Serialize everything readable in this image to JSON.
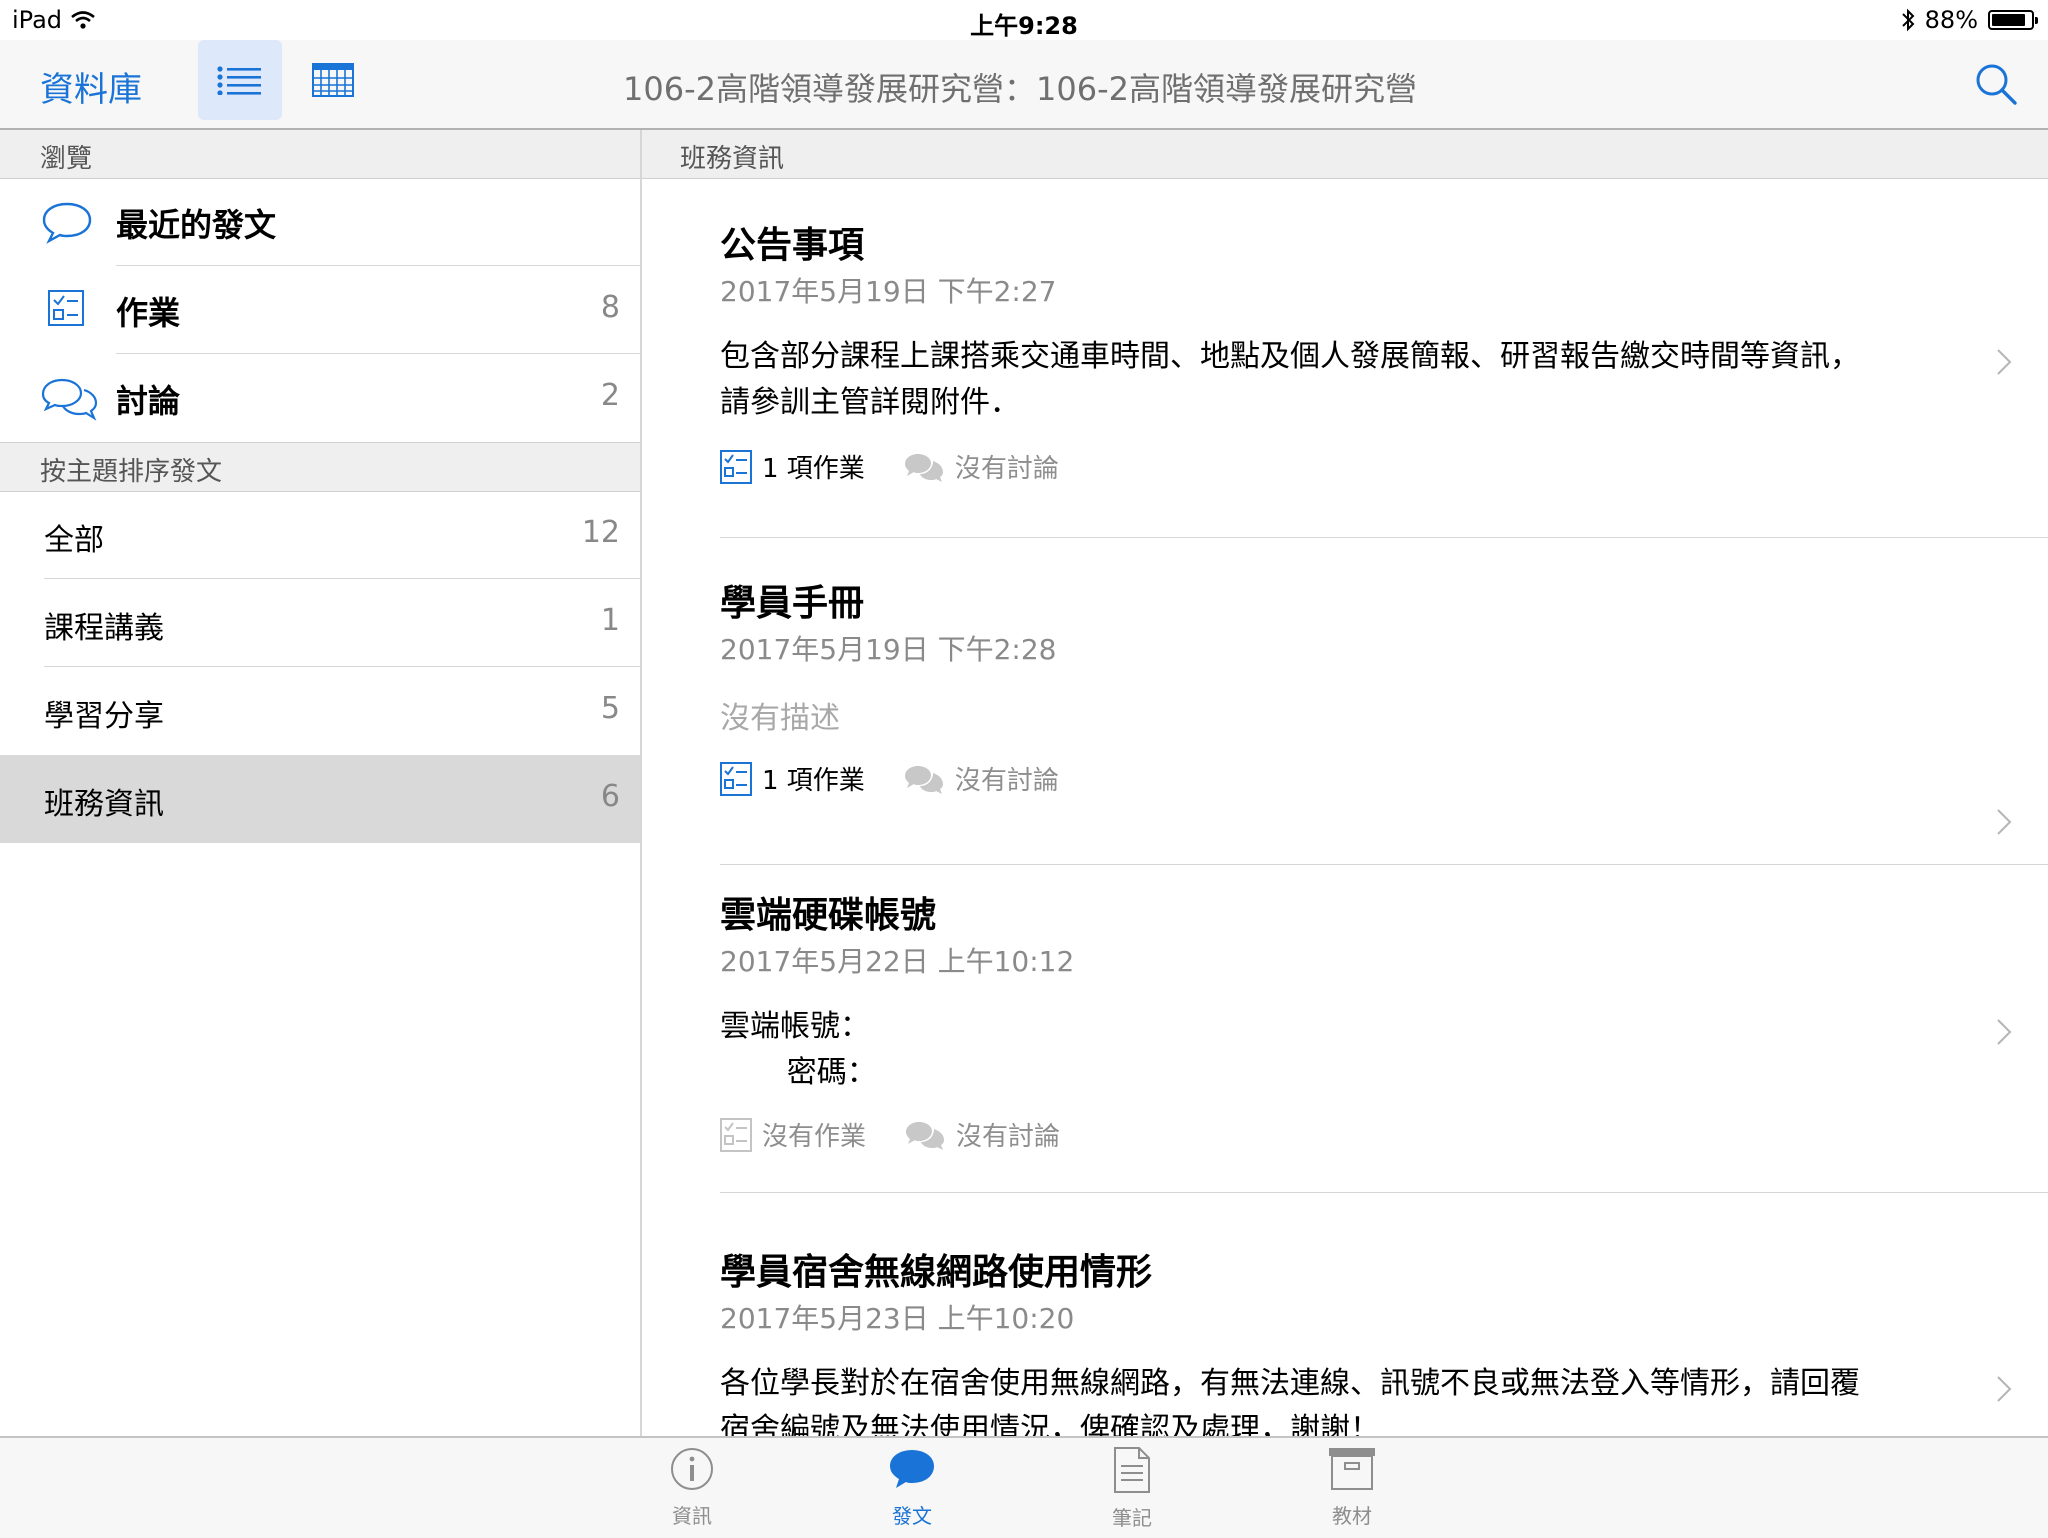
{
  "status_bar": {
    "device": "iPad",
    "time": "上午9:28",
    "battery": "88%",
    "battery_level": 0.88
  },
  "navbar": {
    "back_label": "資料庫",
    "title": "106-2高階領導發展研究營：106-2高階領導發展研究營"
  },
  "sidebar": {
    "browse_header": "瀏覽",
    "browse_items": [
      {
        "label": "最近的發文",
        "count": ""
      },
      {
        "label": "作業",
        "count": "8"
      },
      {
        "label": "討論",
        "count": "2"
      }
    ],
    "topic_header": "按主題排序發文",
    "topics": [
      {
        "label": "全部",
        "count": "12"
      },
      {
        "label": "課程講義",
        "count": "1"
      },
      {
        "label": "學習分享",
        "count": "5"
      },
      {
        "label": "班務資訊",
        "count": "6",
        "selected": true
      }
    ]
  },
  "main": {
    "header": "班務資訊",
    "posts": [
      {
        "title": "公告事項",
        "date": "2017年5月19日 下午2:27",
        "body": "包含部分課程上課搭乘交通車時間、地點及個人發展簡報、研習報告繳交時間等資訊，\n請參訓主管詳閱附件．",
        "assignments": "1 項作業",
        "discussions": "沒有討論"
      },
      {
        "title": "學員手冊",
        "date": "2017年5月19日 下午2:28",
        "body": "沒有描述",
        "assignments": "1 項作業",
        "discussions": "沒有討論"
      },
      {
        "title": "雲端硬碟帳號",
        "date": "2017年5月22日 上午10:12",
        "body": "雲端帳號：\n       密碼：",
        "assignments": "沒有作業",
        "discussions": "沒有討論"
      },
      {
        "title": "學員宿舍無線網路使用情形",
        "date": "2017年5月23日 上午10:20",
        "body": "各位學長對於在宿舍使用無線網路，有無法連線、訊號不良或無法登入等情形，請回覆\n宿舍編號及無法使用情況，俾確認及處理，謝謝！"
      }
    ]
  },
  "tabbar": {
    "tabs": [
      {
        "label": "資訊",
        "icon": "info-icon"
      },
      {
        "label": "發文",
        "icon": "speech-bubble-icon",
        "active": true
      },
      {
        "label": "筆記",
        "icon": "document-icon"
      },
      {
        "label": "教材",
        "icon": "archive-box-icon"
      }
    ]
  },
  "colors": {
    "accent": "#1a73d6",
    "selected_row": "#d9d9d9",
    "section_header": "#efefef"
  }
}
